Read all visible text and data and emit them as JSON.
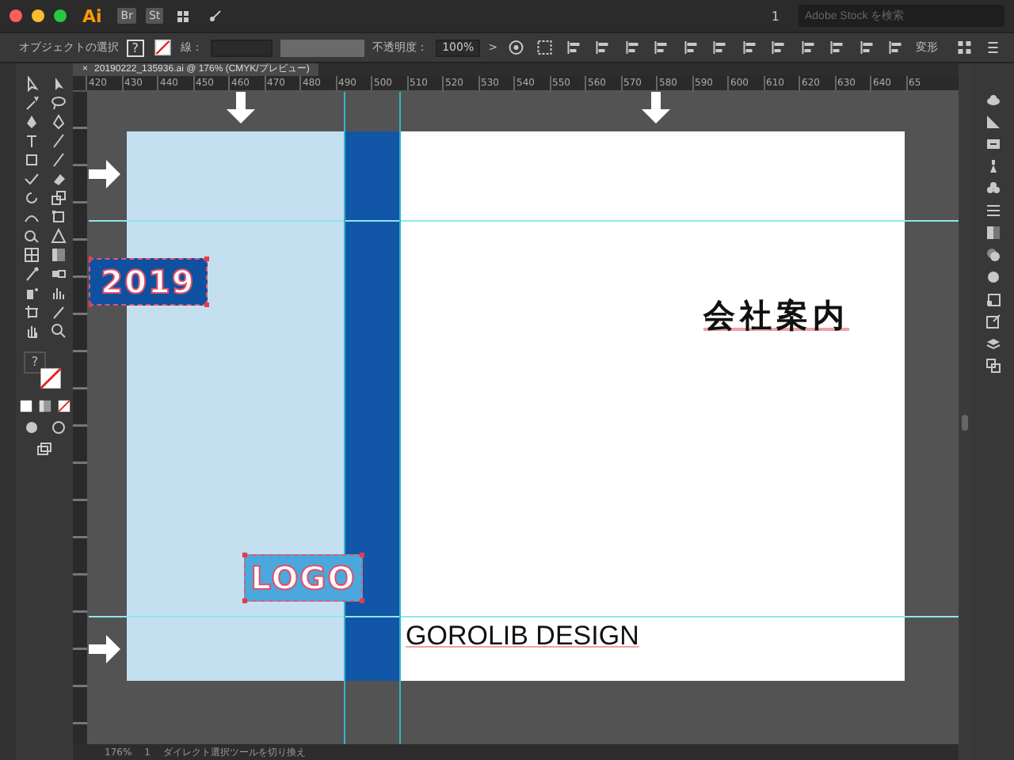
{
  "app_bar": {
    "logo": "Ai",
    "bridge": "Br",
    "stock": "St",
    "page": "1",
    "search": {
      "placeholder": "Adobe Stock を検索"
    }
  },
  "control_bar": {
    "selection_label": "オブジェクトの選択",
    "fill_symbol": "?",
    "stroke_label": "線：",
    "opacity_label": "不透明度：",
    "opacity_value": "100%",
    "more_symbol": ">",
    "transform_label": "変形"
  },
  "document_tab": {
    "close": "×",
    "title": "20190222_135936.ai @ 176% (CMYK/プレビュー)",
    "selected": true
  },
  "ruler": {
    "ticks": [
      "420",
      "430",
      "440",
      "450",
      "460",
      "470",
      "480",
      "490",
      "500",
      "510",
      "520",
      "530",
      "540",
      "550",
      "560",
      "570",
      "580",
      "590",
      "600",
      "610",
      "620",
      "630",
      "640",
      "65"
    ]
  },
  "toolbar": {
    "fill_symbol": "?"
  },
  "artboard": {
    "objects": [
      {
        "kind": "badge",
        "text": "2019",
        "color": "#1050a0"
      },
      {
        "kind": "badge",
        "text": "LOGO",
        "color": "#4aa8dc"
      },
      {
        "kind": "heading",
        "text": "会社案内"
      },
      {
        "kind": "caption",
        "text": "GOROLIB DESIGN"
      }
    ]
  },
  "status_bar": {
    "zoom": "176%",
    "page": "1",
    "tool_hint": "ダイレクト選択ツールを切り換え"
  }
}
